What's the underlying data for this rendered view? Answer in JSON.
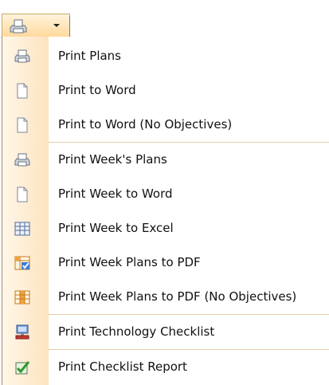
{
  "colors": {
    "accent": "#ffd99b",
    "gutter": "#fde3bf",
    "separator": "#e3cfa9"
  },
  "toolbar": {
    "button": {
      "icon": "printer-icon",
      "dropdown_icon": "chevron-down-icon"
    }
  },
  "menu": {
    "items": [
      {
        "label": "Print Plans",
        "icon": "printer-icon"
      },
      {
        "label": "Print to Word",
        "icon": "document-icon"
      },
      {
        "label": "Print to Word (No Objectives)",
        "icon": "document-icon"
      },
      {
        "label": "Print Week's Plans",
        "icon": "printer-icon"
      },
      {
        "label": "Print Week to Word",
        "icon": "document-icon"
      },
      {
        "label": "Print Week to Excel",
        "icon": "grid-icon"
      },
      {
        "label": "Print Week Plans to PDF",
        "icon": "grid-check-icon"
      },
      {
        "label": "Print Week Plans to PDF (No Objectives)",
        "icon": "grid-orange-icon"
      },
      {
        "label": "Print Technology Checklist",
        "icon": "computer-icon"
      },
      {
        "label": "Print Checklist Report",
        "icon": "checkmark-icon"
      }
    ]
  }
}
